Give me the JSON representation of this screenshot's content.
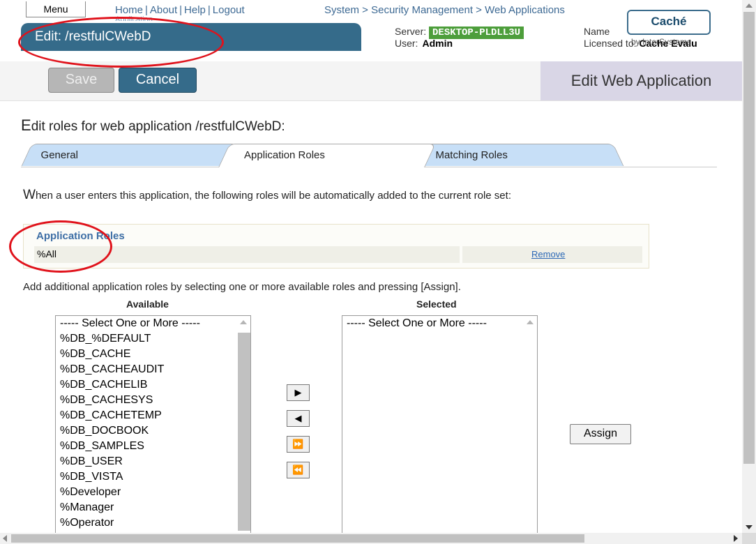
{
  "header": {
    "menu_label": "Menu",
    "links": [
      "Home",
      "About",
      "Help",
      "Logout"
    ],
    "links_sub": "Application",
    "breadcrumb": "System > Security Management > Web Applications",
    "title": "Edit: /restfulCWebD",
    "server_label": "Server:",
    "server_value": "DESKTOP-PLDLL3U",
    "user_label": "User:",
    "user_value": "Admin",
    "name_label": "Name",
    "license_label": "Licensed to:",
    "license_value": "Cache Evalu",
    "logo": "Caché",
    "logo_sub": "by InterSystems"
  },
  "toolbar": {
    "save_label": "Save",
    "cancel_label": "Cancel",
    "page_heading": "Edit Web Application"
  },
  "section": {
    "title_cap": "E",
    "title_rest": "dit roles for web application /restfulCWebD:"
  },
  "tabs": [
    "General",
    "Application Roles",
    "Matching Roles"
  ],
  "intro": {
    "cap": "W",
    "rest": "hen a user enters this application, the following roles will be automatically added to the current role set:"
  },
  "roles_table": {
    "header": "Application Roles",
    "rows": [
      {
        "name": "%All",
        "action": "Remove"
      }
    ]
  },
  "add_text": "Add additional application roles by selecting one or more available roles and pressing [Assign].",
  "available": {
    "label": "Available",
    "options": [
      "----- Select One or More -----",
      "%DB_%DEFAULT",
      "%DB_CACHE",
      "%DB_CACHEAUDIT",
      "%DB_CACHELIB",
      "%DB_CACHESYS",
      "%DB_CACHETEMP",
      "%DB_DOCBOOK",
      "%DB_SAMPLES",
      "%DB_USER",
      "%DB_VISTA",
      "%Developer",
      "%Manager",
      "%Operator"
    ]
  },
  "selected": {
    "label": "Selected",
    "options": [
      "----- Select One or More -----"
    ]
  },
  "move_buttons": [
    "▶",
    "◀",
    "⏩",
    "⏪"
  ],
  "assign_label": "Assign",
  "icons": {
    "move_right": "arrow-right-icon",
    "move_left": "arrow-left-icon",
    "move_all_right": "double-arrow-right-icon",
    "move_all_left": "double-arrow-left-icon"
  },
  "colors": {
    "title_bar": "#356b8a",
    "server_badge": "#4d9e3b",
    "tab_inactive": "#c7dff7",
    "annotation": "#e0121b"
  }
}
